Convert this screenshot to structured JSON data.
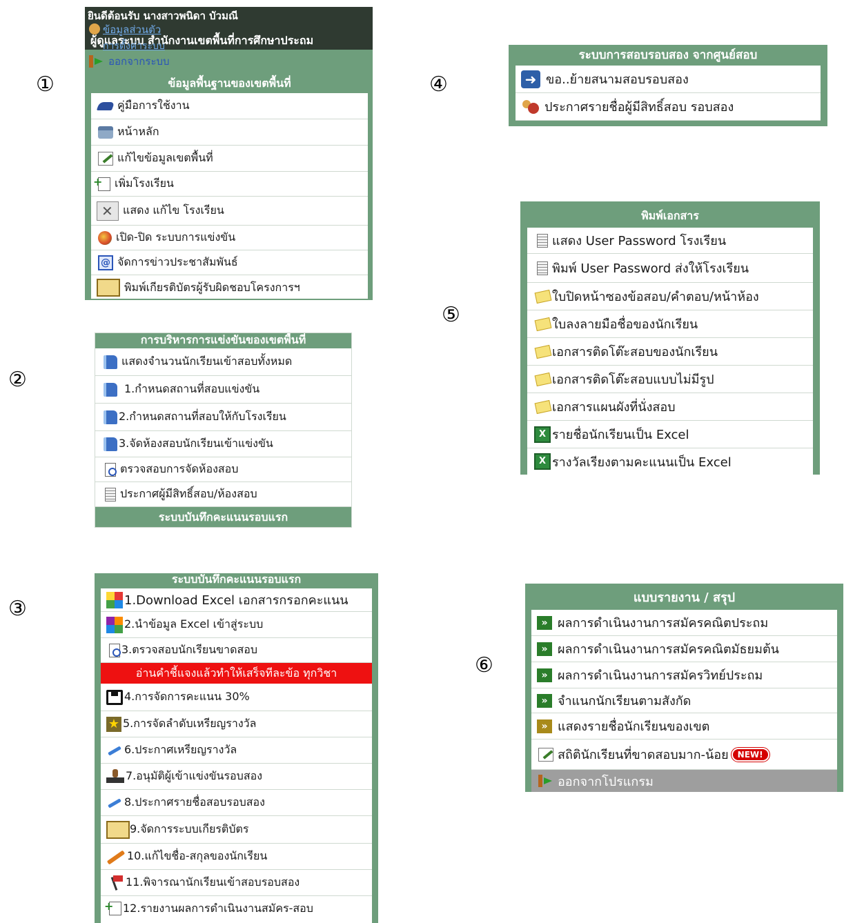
{
  "markers": [
    "①",
    "②",
    "③",
    "④",
    "⑤",
    "⑥"
  ],
  "p1": {
    "welcome": "ยินดีต้อนรับ นางสาวพนิดา บัวมณี",
    "admin": "ผู้ดูแลระบบ สำนักงานเขตพื้นที่การศึกษาประถม",
    "personal": "ข้อมูลส่วนตัว",
    "settings": "การตั้งค่าระบบ",
    "logout": "ออกจากระบบ",
    "header": "ข้อมูลพื้นฐานของเขตพื้นที่",
    "items": [
      "คู่มือการใช้งาน",
      "หน้าหลัก",
      "แก้ไขข้อมูลเขตพื้นที่",
      "เพิ่มโรงเรียน",
      "แสดง แก้ไข โรงเรียน",
      "เปิด-ปิด ระบบการแข่งขัน",
      "จัดการข่าวประชาสัมพันธ์",
      "พิมพ์เกียรติบัตรผู้รับผิดชอบโครงการฯ"
    ]
  },
  "p2": {
    "header": "การบริหารการแข่งขันของเขตพื้นที่",
    "items": [
      "แสดงจำนวนนักเรียนเข้าสอบทั้งหมด",
      "1.กำหนดสถานที่สอบแข่งขัน",
      "2.กำหนดสถานที่สอบให้กับโรงเรียน",
      "3.จัดห้องสอบนักเรียนเข้าแข่งขัน",
      "ตรวจสอบการจัดห้องสอบ",
      "ประกาศผู้มีสิทธิ์สอบ/ห้องสอบ"
    ],
    "footer": "ระบบบันทึกคะแนนรอบแรก"
  },
  "p3": {
    "header": "ระบบบันทึกคะแนนรอบแรก",
    "items_a": [
      "1.Download Excel เอกสารกรอกคะแนน",
      "2.นำข้อมูล Excel เข้าสู่ระบบ",
      "3.ตรวจสอบนักเรียนขาดสอบ"
    ],
    "warning": "อ่านคำชี้แจงแล้วทำให้เสร็จทีละข้อ ทุกวิชา",
    "items_b": [
      "4.การจัดการคะแนน 30%",
      "5.การจัดลำดับเหรียญรางวัล",
      "6.ประกาศเหรียญรางวัล",
      "7.อนุมัติผู้เข้าแข่งขันรอบสอง",
      "8.ประกาศรายชื่อสอบรอบสอง",
      "9.จัดการระบบเกียรติบัตร",
      "10.แก้ไขชื่อ-สกุลของนักเรียน",
      "11.พิจารณานักเรียนเข้าสอบรอบสอง",
      "12.รายงานผลการดำเนินงานสมัคร-สอบ"
    ]
  },
  "p4": {
    "header": "ระบบการสอบรอบสอง จากศูนย์สอบ",
    "items": [
      "ขอ..ย้ายสนามสอบรอบสอง",
      "ประกาศรายชื่อผู้มีสิทธิ์สอบ รอบสอง"
    ]
  },
  "p5": {
    "header": "พิมพ์เอกสาร",
    "items": [
      "แสดง User Password โรงเรียน",
      "พิมพ์ User Password ส่งให้โรงเรียน",
      "ใบปิดหน้าซองข้อสอบ/คำตอบ/หน้าห้อง",
      "ใบลงลายมือชื่อของนักเรียน",
      "เอกสารติดโต๊ะสอบของนักเรียน",
      "เอกสารติดโต๊ะสอบแบบไม่มีรูป",
      "เอกสารแผนผังที่นั่งสอบ",
      "รายชื่อนักเรียนเป็น Excel",
      "รางวัลเรียงตามคะแนนเป็น Excel"
    ]
  },
  "p6": {
    "header": "แบบรายงาน / สรุป",
    "items": [
      "ผลการดำเนินงานการสมัครคณิตประถม",
      "ผลการดำเนินงานการสมัครคณิตมัธยมต้น",
      "ผลการดำเนินงานการสมัครวิทย์ประถม",
      "จำแนกนักเรียนตามสังกัด",
      "แสดงรายชื่อนักเรียนของเขต",
      "สถิตินักเรียนที่ขาดสอบมาก-น้อย"
    ],
    "new_badge": "NEW!",
    "exit": "ออกจากโปรแกรม"
  },
  "colors": {
    "header_green": "#6e9e7c",
    "warning_red": "#ee1111",
    "exit_gray": "#9e9e9e"
  }
}
